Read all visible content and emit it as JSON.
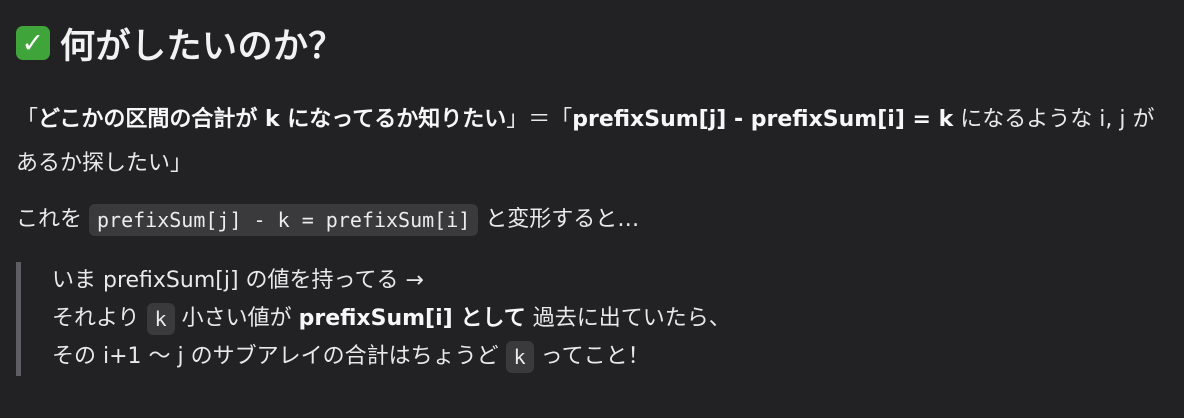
{
  "heading": {
    "icon": "white-check-mark-icon",
    "text": "何がしたいのか？"
  },
  "main": {
    "open_quote": "「",
    "strong_statement_1": "どこかの区間の合計が k になってるか知りたい",
    "close_quote_equals": "」＝「",
    "strong_statement_2": "prefixSum[j] - prefixSum[i] = k",
    "tail": " になるような i, j があるか探したい」"
  },
  "transform": {
    "prefix": "これを ",
    "code": "prefixSum[j] - k = prefixSum[i]",
    "suffix": " と変形すると…"
  },
  "quote": {
    "line1": "いま prefixSum[j] の値を持ってる →",
    "line2_prefix": "それより ",
    "line2_code": "k",
    "line2_mid": " 小さい値が ",
    "line2_strong": "prefixSum[i] として",
    "line2_suffix": " 過去に出ていたら、",
    "line3_prefix": "その i+1 〜 j のサブアレイの合計はちょうど ",
    "line3_code": "k",
    "line3_suffix": " ってこと！"
  },
  "colors": {
    "background": "#222224",
    "text": "#e9e9eb",
    "code_background": "#3a3a3d",
    "quote_border": "#5f5f63",
    "check_green": "#3fa53a"
  }
}
